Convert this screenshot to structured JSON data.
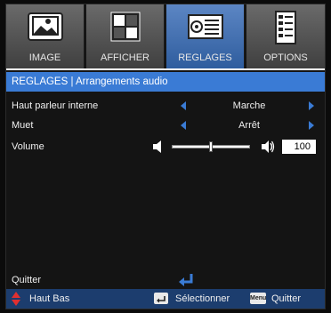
{
  "tabs": [
    {
      "label": "IMAGE",
      "icon": "image-icon",
      "active": false
    },
    {
      "label": "AFFICHER",
      "icon": "display-icon",
      "active": false
    },
    {
      "label": "REGLAGES",
      "icon": "settings-icon",
      "active": true
    },
    {
      "label": "OPTIONS",
      "icon": "options-icon",
      "active": false
    }
  ],
  "subheader": "REGLAGES | Arrangements audio",
  "rows": {
    "speaker": {
      "name": "Haut parleur interne",
      "value": "Marche"
    },
    "mute": {
      "name": "Muet",
      "value": "Arrêt"
    },
    "volume": {
      "name": "Volume",
      "value": "100",
      "level": 0.5
    }
  },
  "quit": {
    "label": "Quitter"
  },
  "footer": {
    "updown": "Haut Bas",
    "select": "Sélectionner",
    "menu_key": "Menu",
    "quit": "Quitter"
  },
  "colors": {
    "accent": "#3a7bd5",
    "footer": "#1c3d6e",
    "danger": "#e03030"
  }
}
